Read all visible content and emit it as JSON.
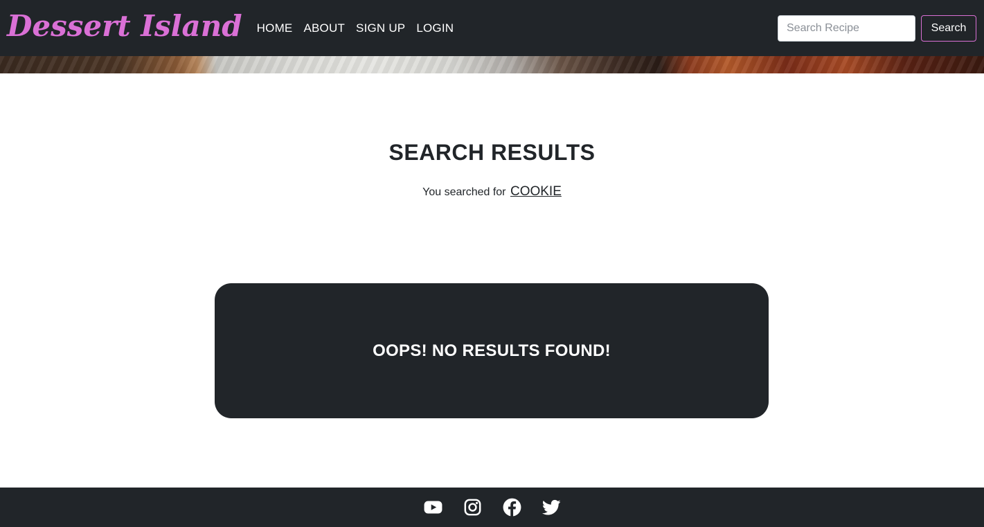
{
  "navbar": {
    "brand": "Dessert Island",
    "links": [
      {
        "label": "HOME"
      },
      {
        "label": "ABOUT"
      },
      {
        "label": "SIGN UP"
      },
      {
        "label": "LOGIN"
      }
    ],
    "search": {
      "placeholder": "Search Recipe",
      "value": "",
      "button_label": "Search"
    }
  },
  "main": {
    "title": "SEARCH RESULTS",
    "searched_prefix": "You searched for",
    "searched_term": "COOKIE",
    "no_results_message": "OOPS! NO RESULTS FOUND!"
  },
  "footer": {
    "social_icons": [
      "youtube-icon",
      "instagram-icon",
      "facebook-icon",
      "twitter-icon"
    ]
  },
  "colors": {
    "navbar_bg": "#212529",
    "brand": "#da70d6",
    "search_button_border": "#da70d6",
    "results_box_bg": "#212529",
    "footer_bg": "#212529",
    "text": "#212529"
  }
}
